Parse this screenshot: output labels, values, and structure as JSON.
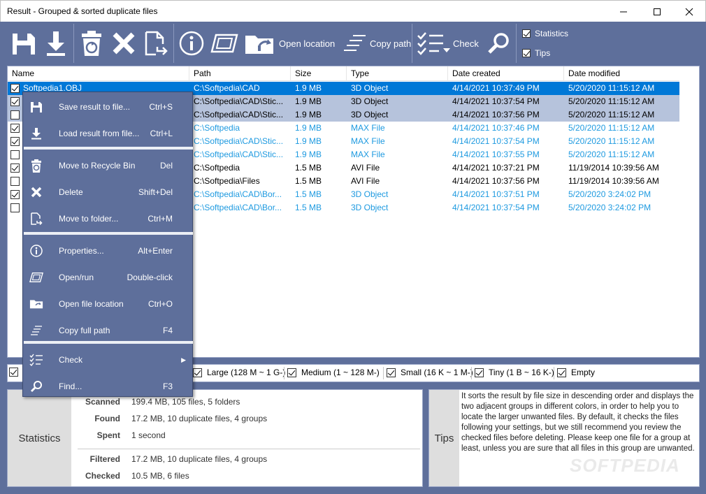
{
  "window": {
    "title": "Result - Grouped & sorted duplicate files"
  },
  "toolbar": {
    "open_location": "Open location",
    "copy_path": "Copy path",
    "check": "Check",
    "statistics": "Statistics",
    "tips": "Tips",
    "statistics_checked": true,
    "tips_checked": true
  },
  "list": {
    "columns": [
      "Name",
      "Path",
      "Size",
      "Type",
      "Date created",
      "Date modified"
    ],
    "rows": [
      {
        "name": "Softpedia1.OBJ",
        "path": "C:\\Softpedia\\CAD",
        "size": "1.9 MB",
        "type": "3D Object",
        "created": "4/14/2021 10:37:49 PM",
        "modified": "5/20/2020 11:15:12 AM",
        "checked": true,
        "style": "sel"
      },
      {
        "name": "",
        "path": "C:\\Softpedia\\CAD\\Stic...",
        "size": "1.9 MB",
        "type": "3D Object",
        "created": "4/14/2021 10:37:54 PM",
        "modified": "5/20/2020 11:15:12 AM",
        "checked": true,
        "style": "hl"
      },
      {
        "name": "",
        "path": "C:\\Softpedia\\CAD\\Stic...",
        "size": "1.9 MB",
        "type": "3D Object",
        "created": "4/14/2021 10:37:56 PM",
        "modified": "5/20/2020 11:15:12 AM",
        "checked": false,
        "style": "hl"
      },
      {
        "name": "",
        "path": "C:\\Softpedia",
        "size": "1.9 MB",
        "type": "MAX File",
        "created": "4/14/2021 10:37:46 PM",
        "modified": "5/20/2020 11:15:12 AM",
        "checked": true,
        "style": "blue"
      },
      {
        "name": "",
        "path": "C:\\Softpedia\\CAD\\Stic...",
        "size": "1.9 MB",
        "type": "MAX File",
        "created": "4/14/2021 10:37:54 PM",
        "modified": "5/20/2020 11:15:12 AM",
        "checked": true,
        "style": "blue"
      },
      {
        "name": "",
        "path": "C:\\Softpedia\\CAD\\Stic...",
        "size": "1.9 MB",
        "type": "MAX File",
        "created": "4/14/2021 10:37:55 PM",
        "modified": "5/20/2020 11:15:12 AM",
        "checked": false,
        "style": "blue"
      },
      {
        "name": "",
        "path": "C:\\Softpedia",
        "size": "1.5 MB",
        "type": "AVI File",
        "created": "4/14/2021 10:37:21 PM",
        "modified": "11/19/2014 10:39:56 AM",
        "checked": true,
        "style": "black"
      },
      {
        "name": "",
        "path": "C:\\Softpedia\\Files",
        "size": "1.5 MB",
        "type": "AVI File",
        "created": "4/14/2021 10:37:56 PM",
        "modified": "11/19/2014 10:39:56 AM",
        "checked": false,
        "style": "black"
      },
      {
        "name": "",
        "path": "C:\\Softpedia\\CAD\\Bor...",
        "size": "1.5 MB",
        "type": "3D Object",
        "created": "4/14/2021 10:37:51 PM",
        "modified": "5/20/2020 3:24:02 PM",
        "checked": true,
        "style": "blue"
      },
      {
        "name": "",
        "path": "C:\\Softpedia\\CAD\\Bor...",
        "size": "1.5 MB",
        "type": "3D Object",
        "created": "4/14/2021 10:37:54 PM",
        "modified": "5/20/2020 3:24:02 PM",
        "checked": false,
        "style": "blue"
      }
    ]
  },
  "filters": [
    {
      "label": "Large (128 M ~ 1 G-)",
      "checked": true
    },
    {
      "label": "Medium (1 ~ 128 M-)",
      "checked": true
    },
    {
      "label": "Small (16 K ~ 1 M-)",
      "checked": true
    },
    {
      "label": "Tiny (1 B ~ 16 K-)",
      "checked": true
    },
    {
      "label": "Empty",
      "checked": true
    }
  ],
  "statistics": {
    "label": "Statistics",
    "scanned_key": "Scanned",
    "scanned": "199.4 MB, 105 files, 5 folders",
    "found_key": "Found",
    "found": "17.2 MB, 10 duplicate files, 4 groups",
    "spent_key": "Spent",
    "spent": "1 second",
    "filtered_key": "Filtered",
    "filtered": "17.2 MB, 10 duplicate files, 4 groups",
    "checked_key": "Checked",
    "checked": "10.5 MB, 6 files"
  },
  "tips": {
    "label": "Tips",
    "text": "It sorts the result by file size in descending order and displays the two adjacent groups in different colors, in order to help you to locate the larger unwanted files. By default, it checks the files following your settings, but we still recommend you review the checked files before deleting. Please keep one file for a group at least, unless you are sure that all files in this group are unwanted."
  },
  "watermark": "SOFTPEDIA",
  "context_menu": {
    "items": [
      {
        "label": "Save result to file...",
        "key": "Ctrl+S",
        "icon": "save-icon"
      },
      {
        "label": "Load result from file...",
        "key": "Ctrl+L",
        "icon": "download-icon"
      },
      {
        "label": "Move to Recycle Bin",
        "key": "Del",
        "icon": "recycle-bin-icon"
      },
      {
        "label": "Delete",
        "key": "Shift+Del",
        "icon": "delete-x-icon"
      },
      {
        "label": "Move to folder...",
        "key": "Ctrl+M",
        "icon": "move-file-icon"
      },
      {
        "label": "Properties...",
        "key": "Alt+Enter",
        "icon": "info-icon"
      },
      {
        "label": "Open/run",
        "key": "Double-click",
        "icon": "open-run-icon"
      },
      {
        "label": "Open file location",
        "key": "Ctrl+O",
        "icon": "open-location-icon"
      },
      {
        "label": "Copy full path",
        "key": "F4",
        "icon": "copy-path-icon"
      },
      {
        "label": "Check",
        "key": "",
        "icon": "check-list-icon"
      },
      {
        "label": "Find...",
        "key": "F3",
        "icon": "search-icon"
      }
    ]
  },
  "colors": {
    "accent": "#5e6f9b",
    "selection": "#0078d7",
    "group_highlight": "#b6c3dc",
    "blue_text": "#1e9ae0"
  }
}
